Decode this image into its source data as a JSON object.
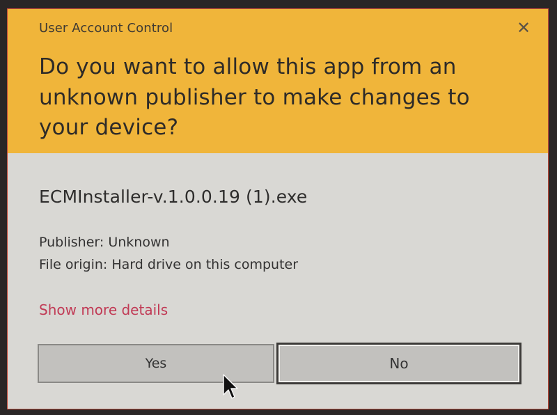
{
  "window": {
    "title": "User Account Control",
    "close_glyph": "✕"
  },
  "prompt": {
    "question": "Do you want to allow this app from an unknown publisher to make changes to your device?"
  },
  "app": {
    "name": "ECMInstaller-v.1.0.0.19 (1).exe",
    "publisher": "Publisher: Unknown",
    "file_origin": "File origin: Hard drive on this computer"
  },
  "details_link": "Show more details",
  "buttons": {
    "yes": "Yes",
    "no": "No"
  },
  "colors": {
    "header": "#f0b53a",
    "body": "#d9d8d4",
    "link": "#c13a55"
  },
  "icons": {
    "close": "close-icon",
    "cursor": "mouse-pointer-icon"
  }
}
